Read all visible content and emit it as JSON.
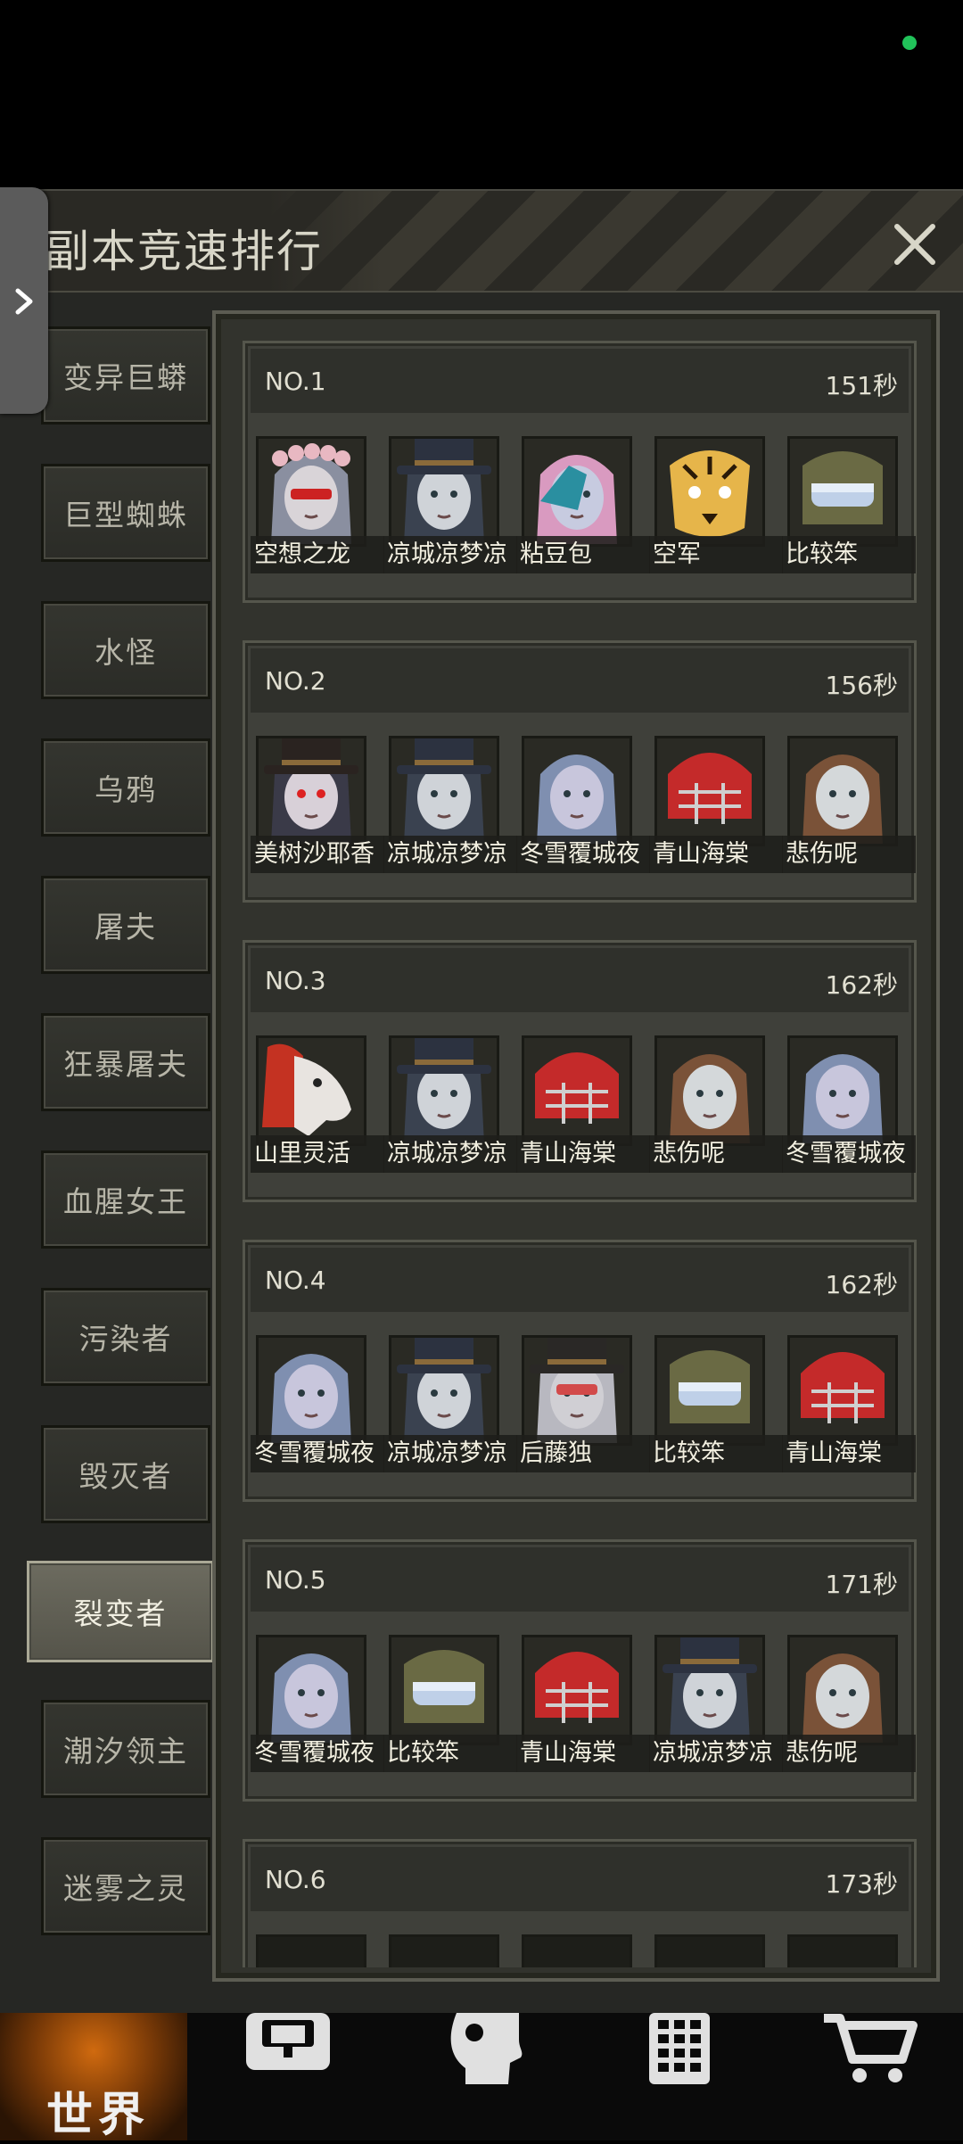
{
  "title": "副本竞速排行",
  "categories": [
    "变异巨蟒",
    "巨型蜘蛛",
    "水怪",
    "乌鸦",
    "屠夫",
    "狂暴屠夫",
    "血腥女王",
    "污染者",
    "毁灭者",
    "裂变者",
    "潮汐领主",
    "迷雾之灵"
  ],
  "active_category": "裂变者",
  "rankings": [
    {
      "no": "NO.1",
      "time": "151秒",
      "players": [
        "空想之龙",
        "凉城凉梦凉",
        "粘豆包",
        "空军",
        "比较笨"
      ]
    },
    {
      "no": "NO.2",
      "time": "156秒",
      "players": [
        "美树沙耶香",
        "凉城凉梦凉",
        "冬雪覆城夜",
        "青山海棠",
        "悲伤呢"
      ]
    },
    {
      "no": "NO.3",
      "time": "162秒",
      "players": [
        "山里灵活",
        "凉城凉梦凉",
        "青山海棠",
        "悲伤呢",
        "冬雪覆城夜"
      ]
    },
    {
      "no": "NO.4",
      "time": "162秒",
      "players": [
        "冬雪覆城夜",
        "凉城凉梦凉",
        "后藤独",
        "比较笨",
        "青山海棠"
      ]
    },
    {
      "no": "NO.5",
      "time": "171秒",
      "players": [
        "冬雪覆城夜",
        "比较笨",
        "青山海棠",
        "凉城凉梦凉",
        "悲伤呢"
      ]
    },
    {
      "no": "NO.6",
      "time": "173秒",
      "players": []
    }
  ],
  "nav": {
    "world_label": "世界"
  },
  "icons": {
    "close": "close-icon",
    "expand": "chevron-right-icon",
    "backpack": "backpack-icon",
    "head": "head-icon",
    "phone": "phone-icon",
    "cart": "cart-icon"
  },
  "colors": {
    "status_dot": "#21c35a",
    "world_tab": "#d06a0f"
  }
}
